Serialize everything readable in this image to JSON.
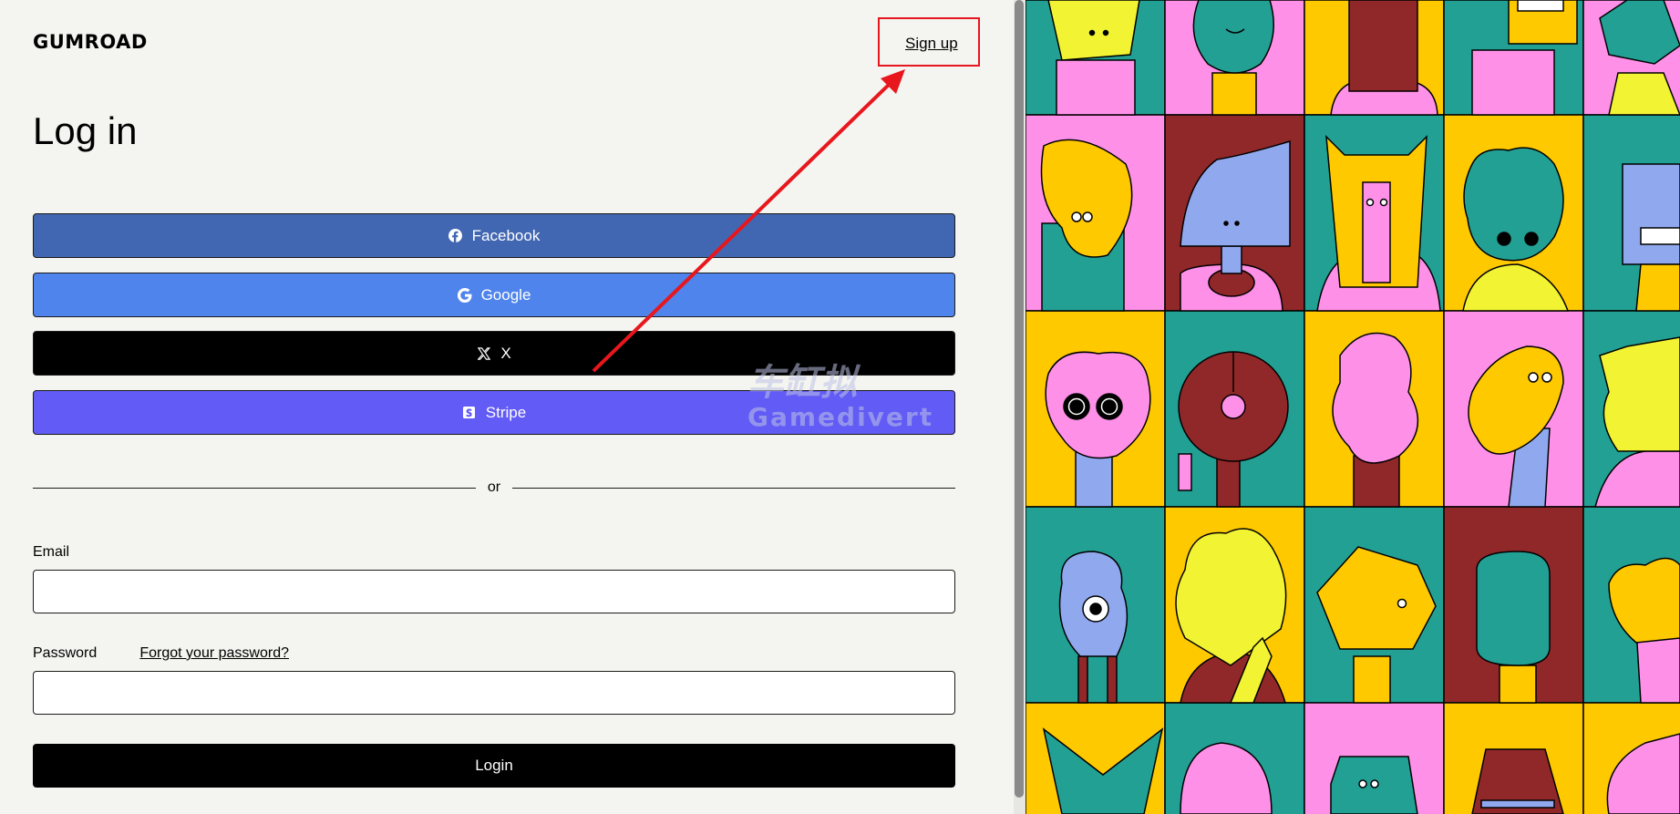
{
  "brand": {
    "logo_text": "GUMROAD"
  },
  "header": {
    "signup_label": "Sign up"
  },
  "page": {
    "title": "Log in"
  },
  "sso_buttons": [
    {
      "id": "facebook",
      "label": "Facebook",
      "icon": "facebook-icon"
    },
    {
      "id": "google",
      "label": "Google",
      "icon": "google-icon"
    },
    {
      "id": "x",
      "label": "X",
      "icon": "x-icon"
    },
    {
      "id": "stripe",
      "label": "Stripe",
      "icon": "stripe-icon"
    }
  ],
  "divider": {
    "text": "or"
  },
  "form": {
    "email_label": "Email",
    "email_value": "",
    "password_label": "Password",
    "password_value": "",
    "forgot_label": "Forgot your password?",
    "submit_label": "Login"
  },
  "watermark": {
    "line1": "车缸拟",
    "line2": "Gamedivert"
  },
  "colors": {
    "facebook": "#4267b2",
    "google": "#4f84ec",
    "x": "#000000",
    "stripe": "#625bf5",
    "annotation": "#e8161d",
    "art_pink": "#ff90e8",
    "art_teal": "#23a094",
    "art_yellow": "#ffc900",
    "art_lime": "#f1f333",
    "art_red": "#90282a",
    "art_blue": "#90a8ed"
  }
}
